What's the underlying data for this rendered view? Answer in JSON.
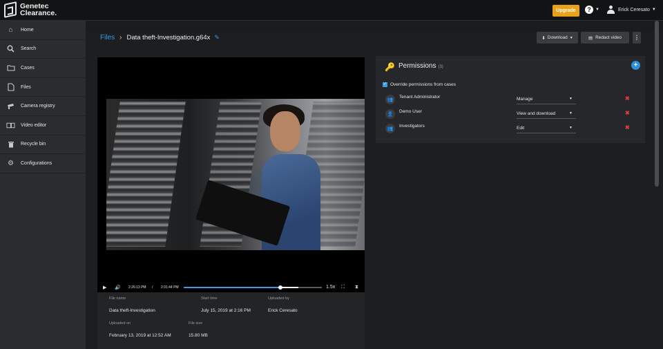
{
  "brand": {
    "name_line1": "Genetec",
    "name_line2": "Clearance."
  },
  "topbar": {
    "upgrade_label": "Upgrade",
    "help_icon": "question-circle-icon",
    "user_name": "Erick Ceresato"
  },
  "sidebar": {
    "items": [
      {
        "label": "Home",
        "icon": "home-icon"
      },
      {
        "label": "Search",
        "icon": "search-icon"
      },
      {
        "label": "Cases",
        "icon": "folder-icon"
      },
      {
        "label": "Files",
        "icon": "file-icon"
      },
      {
        "label": "Camera registry",
        "icon": "camera-icon"
      },
      {
        "label": "Video editor",
        "icon": "film-icon"
      },
      {
        "label": "Recycle bin",
        "icon": "trash-icon"
      },
      {
        "label": "Configurations",
        "icon": "gear-icon"
      }
    ]
  },
  "breadcrumb": {
    "root": "Files",
    "file": "Data theft-Investigation.g64x"
  },
  "toolbar": {
    "download_label": "Download",
    "redact_label": "Redact video"
  },
  "player": {
    "current_time": "2:26:13 PM",
    "separator": "/",
    "end_time": "2:31:44 PM",
    "rate": "1.5x",
    "progress": 0.7,
    "buffered_to": 0.83
  },
  "file_info": {
    "file_name_label": "File name",
    "file_name": "Data theft-Investigation",
    "start_time_label": "Start time",
    "start_time": "July 15, 2019 at 2:16 PM",
    "uploaded_by_label": "Uploaded by",
    "uploaded_by": "Erick Ceresato",
    "uploaded_on_label": "Uploaded on",
    "uploaded_on": "February 13, 2019 at 12:52 AM",
    "file_size_label": "File size",
    "file_size": "15.80 MB"
  },
  "permissions": {
    "title": "Permissions",
    "count": "(3)",
    "override_label": "Override permissions from cases",
    "override_checked": true,
    "rows": [
      {
        "name": "Tenant Administrator",
        "access": "Manage",
        "icon": "group-icon"
      },
      {
        "name": "Demo User",
        "access": "View and download",
        "icon": "user-icon"
      },
      {
        "name": "Investigators",
        "access": "Edit",
        "icon": "group-icon"
      }
    ]
  },
  "colors": {
    "accent": "#3a9be6",
    "upgrade": "#e8a21a",
    "delete": "#e03a3a"
  }
}
